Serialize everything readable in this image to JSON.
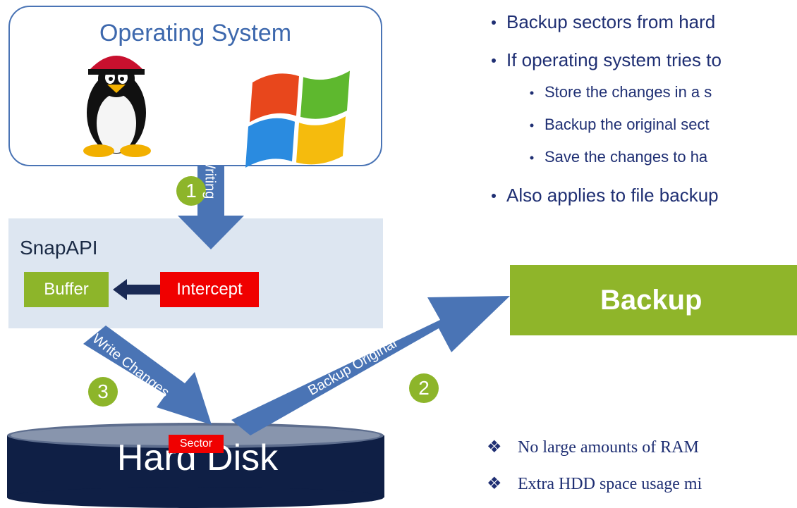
{
  "os": {
    "title": "Operating System"
  },
  "snapapi": {
    "label": "SnapAPI",
    "buffer": "Buffer",
    "intercept": "Intercept"
  },
  "backup": {
    "label": "Backup"
  },
  "disk": {
    "label": "Hard Disk",
    "sector": "Sector"
  },
  "steps": {
    "one": "1",
    "two": "2",
    "three": "3"
  },
  "arrows": {
    "writing": "Writing",
    "write_changes": "Write Changes",
    "backup_original": "Backup Original"
  },
  "bullets": {
    "b1": "Backup sectors from hard",
    "b2": "If operating system tries to",
    "b2a": "Store the changes in a s",
    "b2b": "Backup the original sect",
    "b2c": "Save the changes to ha",
    "b3": "Also applies to file backup"
  },
  "notes": {
    "n1": "No large amounts of RAM",
    "n2": "Extra HDD space usage mi"
  },
  "colors": {
    "accent_blue": "#4a74b5",
    "green": "#8db52a",
    "red": "#f00000",
    "navy": "#1f2f73",
    "disk": "#0f1f45"
  },
  "icons": [
    "linux-tux-icon",
    "windows-logo-icon",
    "bullet-dot-icon",
    "diamond-bullet-icon"
  ]
}
